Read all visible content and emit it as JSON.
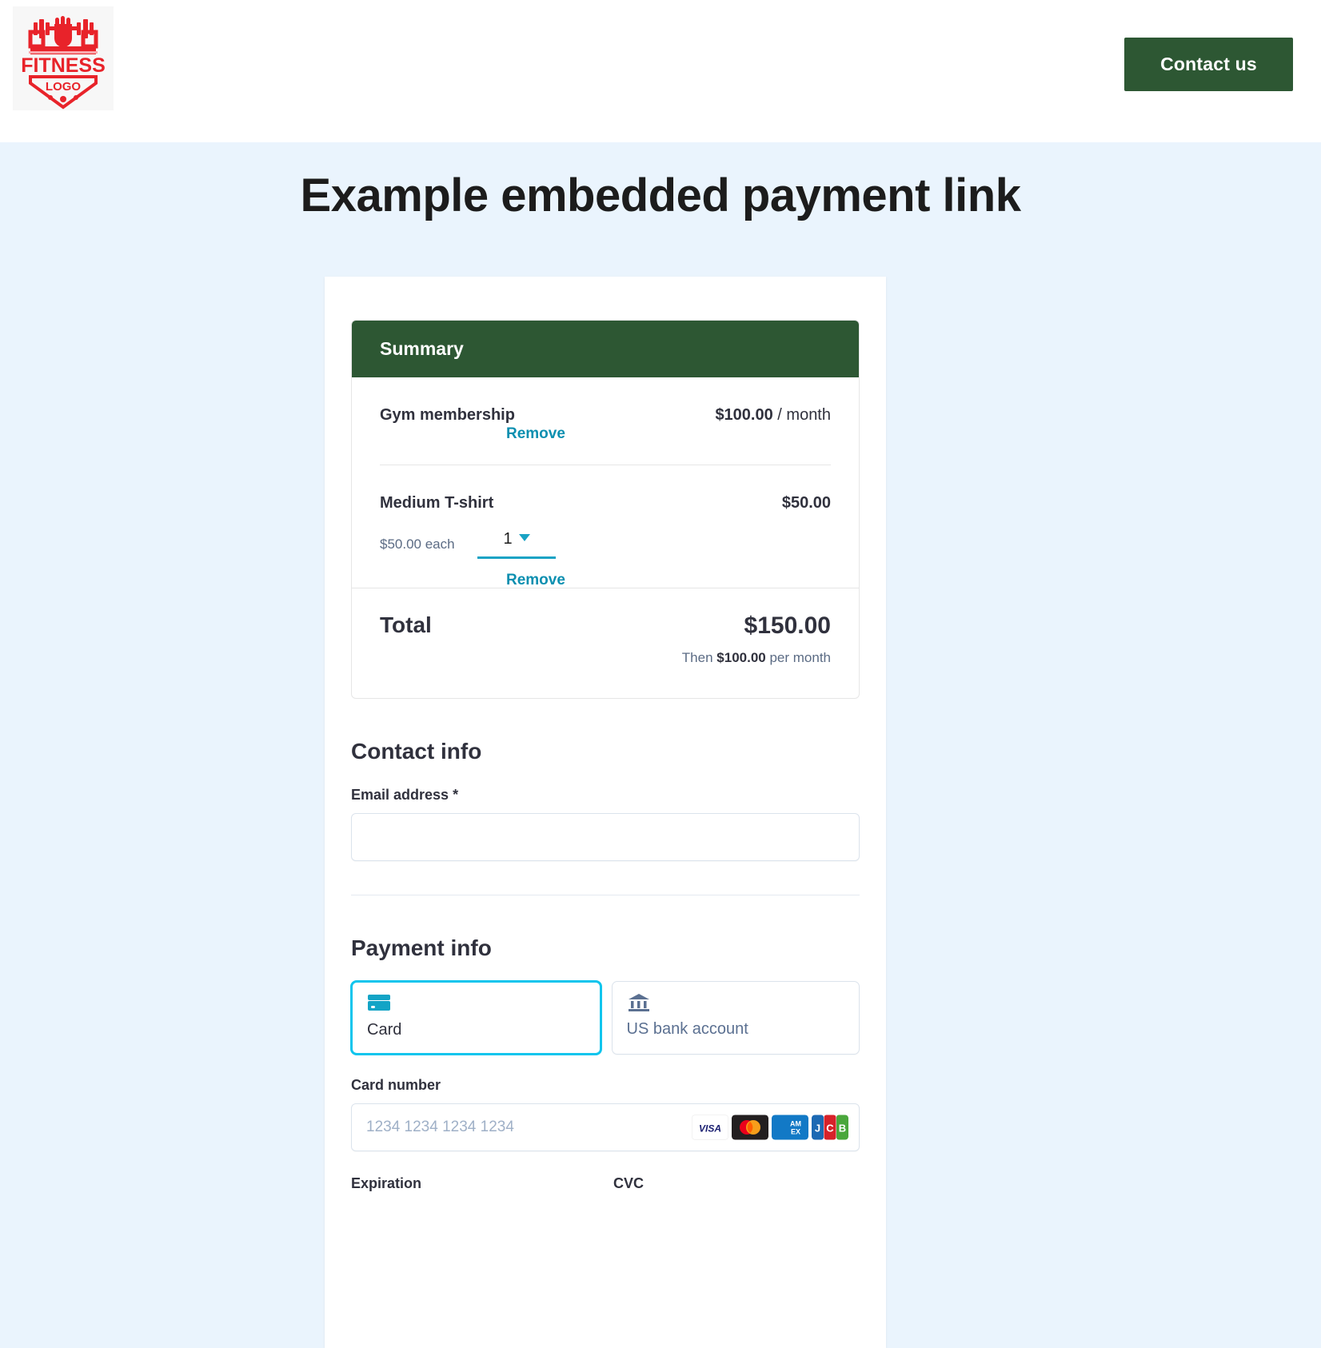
{
  "header": {
    "logo_alt": "FITNESS LOGO",
    "logo_text_main": "FITNESS",
    "logo_text_sub": "LOGO",
    "contact_button": "Contact us",
    "accent_green": "#2d5733"
  },
  "page": {
    "title": "Example embedded payment link",
    "background": "#eaf4fd"
  },
  "summary": {
    "heading": "Summary",
    "items": [
      {
        "name": "Gym membership",
        "price": "$100.00",
        "interval": " / month",
        "each": "",
        "quantity": "",
        "remove_label": "Remove"
      },
      {
        "name": "Medium T-shirt",
        "price": "$50.00",
        "interval": "",
        "each": "$50.00 each",
        "quantity": "1",
        "remove_label": "Remove"
      }
    ],
    "total_label": "Total",
    "total_amount": "$150.00",
    "recurring_prefix": "Then ",
    "recurring_amount": "$100.00",
    "recurring_suffix": " per month"
  },
  "contact_info": {
    "section_title": "Contact info",
    "email_label": "Email address *",
    "email_value": "",
    "email_placeholder": ""
  },
  "payment_info": {
    "section_title": "Payment info",
    "tabs": [
      {
        "label": "Card",
        "icon": "credit-card-icon",
        "selected": true
      },
      {
        "label": "US bank account",
        "icon": "bank-icon",
        "selected": false
      }
    ],
    "card_number_label": "Card number",
    "card_number_value": "",
    "card_number_placeholder": "1234 1234 1234 1234",
    "brands": [
      "visa",
      "mastercard",
      "amex",
      "jcb"
    ],
    "expiration_label": "Expiration",
    "cvc_label": "CVC"
  },
  "colors": {
    "brand_green": "#2d5733",
    "link_teal": "#0b8fb0",
    "select_underline": "#1aa3c4",
    "tab_selected_border": "#0fc5ed",
    "text_dark": "#30313d",
    "text_muted": "#5b6b84"
  }
}
